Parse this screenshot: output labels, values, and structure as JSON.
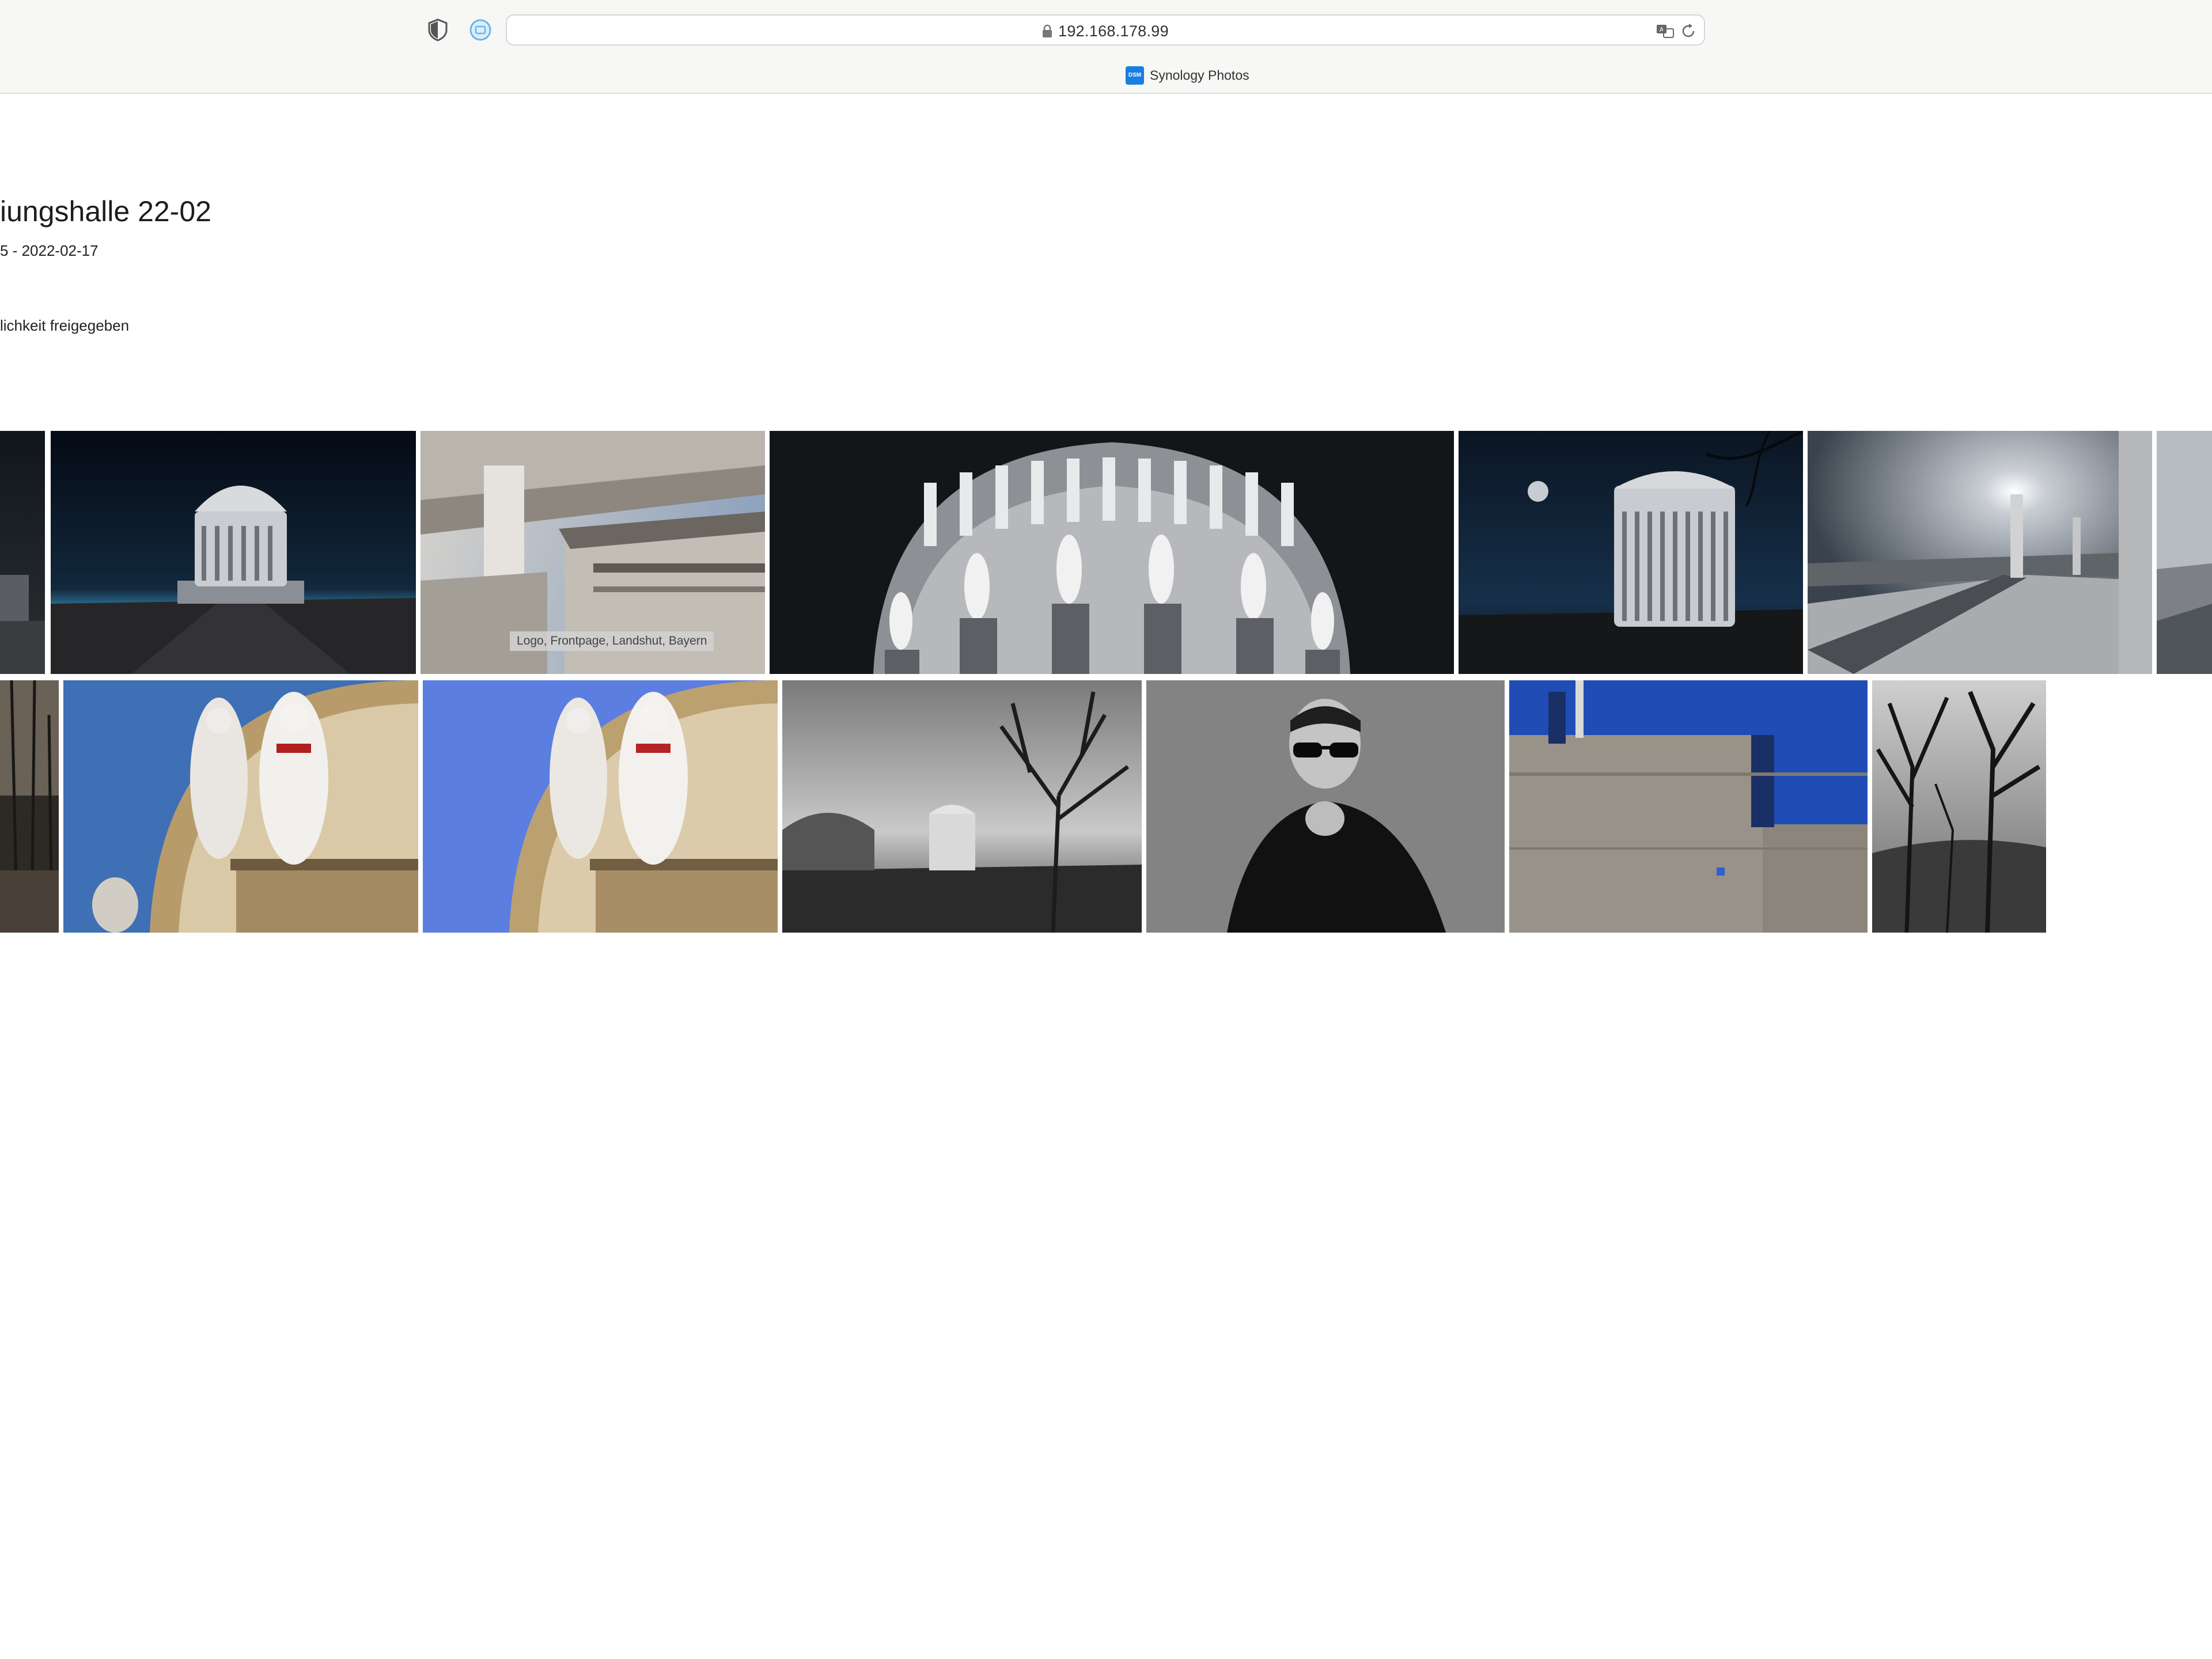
{
  "browser": {
    "url": "192.168.178.99",
    "tab_title": "Synology Photos",
    "favicon_label": "DSM"
  },
  "album": {
    "title": "iungshalle 22-02",
    "meta": "5 - 2022-02-17",
    "share_status": "lichkeit freigegeben"
  },
  "photos": [
    {
      "id": "row1-partial-left",
      "caption": ""
    },
    {
      "id": "row1-hall-night",
      "caption": ""
    },
    {
      "id": "row1-facade-detail",
      "caption": "Logo, Frontpage, Landshut, Bayern"
    },
    {
      "id": "row1-dome-statues",
      "caption": ""
    },
    {
      "id": "row1-hall-moon",
      "caption": ""
    },
    {
      "id": "row1-columns-sun",
      "caption": ""
    },
    {
      "id": "row1-partial-right",
      "caption": ""
    },
    {
      "id": "row2-partial-left",
      "caption": ""
    },
    {
      "id": "row2-statues-blue-1",
      "caption": ""
    },
    {
      "id": "row2-statues-blue-2",
      "caption": ""
    },
    {
      "id": "row2-hall-trees-bw",
      "caption": ""
    },
    {
      "id": "row2-portrait-sunglasses",
      "caption": ""
    },
    {
      "id": "row2-concrete-wall",
      "caption": ""
    },
    {
      "id": "row2-bare-trees",
      "caption": ""
    }
  ]
}
